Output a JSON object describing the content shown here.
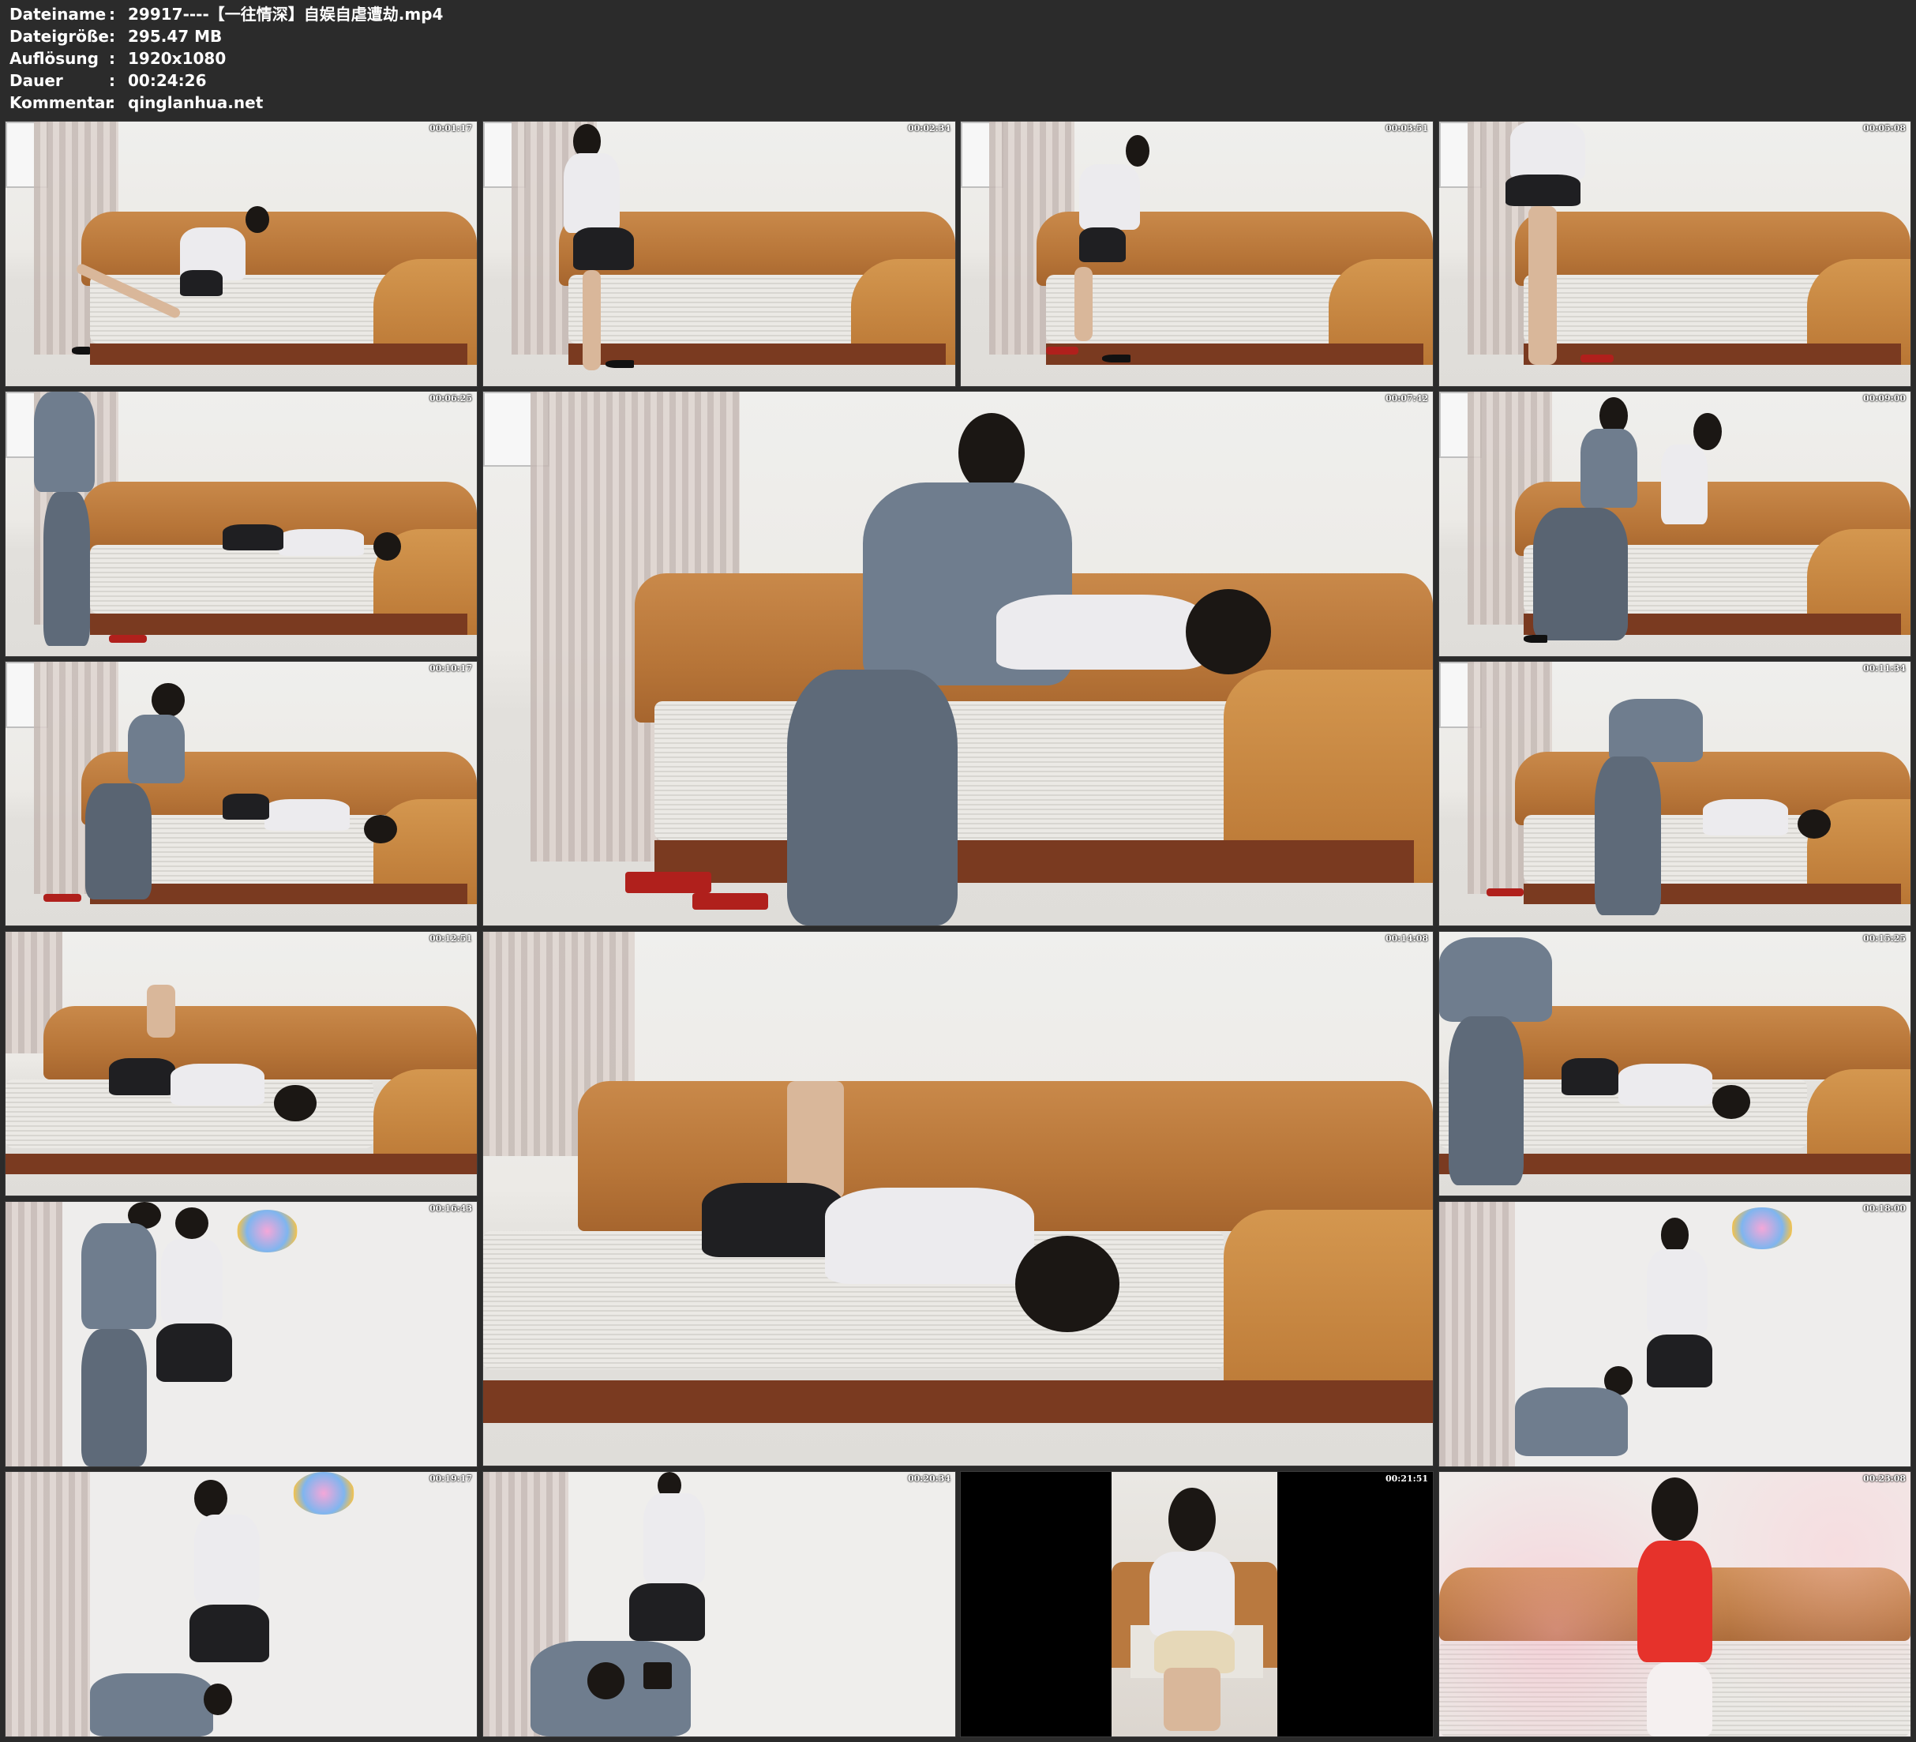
{
  "metadata": [
    {
      "label": "Dateiname",
      "separator": ":",
      "value": "29917----【一往情深】自娱自虐遭劫.mp4"
    },
    {
      "label": "Dateigröße",
      "separator": ":",
      "value": "295.47 MB"
    },
    {
      "label": "Auflösung",
      "separator": ":",
      "value": "1920x1080"
    },
    {
      "label": "Dauer",
      "separator": ":",
      "value": "00:24:26"
    },
    {
      "label": "Kommentar",
      "separator": ":",
      "value": "qinglanhua.net"
    }
  ],
  "thumbnails": [
    {
      "timestamp": "00:01:17",
      "scene": "sofa-woman-reclining"
    },
    {
      "timestamp": "00:02:34",
      "scene": "sofa-woman-sitting"
    },
    {
      "timestamp": "00:03:51",
      "scene": "sofa-woman-sitting"
    },
    {
      "timestamp": "00:05:08",
      "scene": "sofa-woman-standing"
    },
    {
      "timestamp": "00:06:25",
      "scene": "sofa-man-standing"
    },
    {
      "timestamp": "00:07:42",
      "scene": "sofa-man-sitting"
    },
    {
      "timestamp": "00:09:00",
      "scene": "sofa-man-sitting"
    },
    {
      "timestamp": "00:10:17",
      "scene": "sofa-man-sitting"
    },
    {
      "timestamp": "00:11:34",
      "scene": "sofa-man-bending"
    },
    {
      "timestamp": "00:12:51",
      "scene": "sofa-woman-lying"
    },
    {
      "timestamp": "00:14:08",
      "scene": "sofa-woman-lying"
    },
    {
      "timestamp": "00:15:25",
      "scene": "sofa-man-bending"
    },
    {
      "timestamp": "00:16:43",
      "scene": "wall-man-woman"
    },
    {
      "timestamp": "00:18:00",
      "scene": "wall-man-kneeling"
    },
    {
      "timestamp": "00:19:17",
      "scene": "wall-man-kneeling"
    },
    {
      "timestamp": "00:20:34",
      "scene": "wall-man-camera"
    },
    {
      "timestamp": "00:21:51",
      "scene": "sofa-woman-portrait"
    },
    {
      "timestamp": "00:23:08",
      "scene": "sofa-red-dress"
    }
  ]
}
